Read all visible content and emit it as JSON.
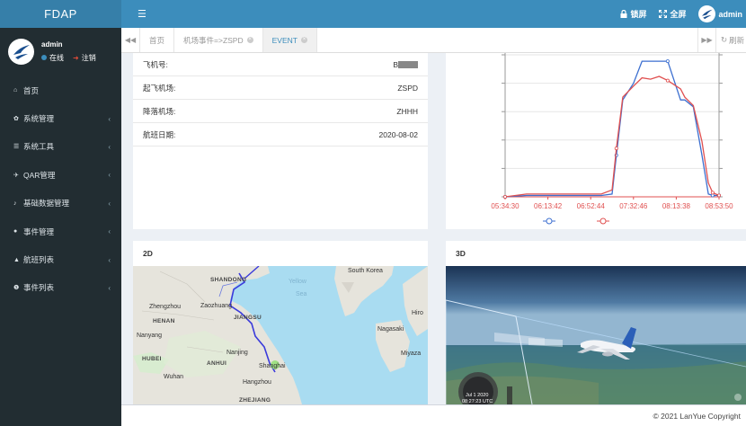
{
  "app": {
    "logo": "FDAP"
  },
  "user": {
    "name": "admin",
    "status_online": "在线",
    "status_logout": "注销"
  },
  "sidebar": {
    "items": [
      {
        "icon": "home-icon",
        "label": "首页",
        "has_children": false
      },
      {
        "icon": "gear-icon",
        "label": "系统管理",
        "has_children": true
      },
      {
        "icon": "list-icon",
        "label": "系统工具",
        "has_children": true
      },
      {
        "icon": "plane-icon",
        "label": "QAR管理",
        "has_children": true
      },
      {
        "icon": "bell-icon",
        "label": "基础数据管理",
        "has_children": true
      },
      {
        "icon": "circle-icon",
        "label": "事件管理",
        "has_children": true
      },
      {
        "icon": "warning-icon",
        "label": "航班列表",
        "has_children": true
      },
      {
        "icon": "info-icon",
        "label": "事件列表",
        "has_children": true
      }
    ]
  },
  "header": {
    "lock_label": "锁屏",
    "fullscreen_label": "全屏",
    "user_label": "admin"
  },
  "tabs": {
    "items": [
      {
        "label": "首页",
        "closable": false,
        "active": false
      },
      {
        "label": "机场事件=>ZSPD",
        "closable": true,
        "active": false
      },
      {
        "label": "EVENT",
        "closable": true,
        "active": true
      }
    ],
    "refresh_label": "刷新"
  },
  "flight_info": {
    "rows": [
      {
        "label": "飞机号:",
        "value": "B"
      },
      {
        "label": "起飞机场:",
        "value": "ZSPD"
      },
      {
        "label": "降落机场:",
        "value": "ZHHH"
      },
      {
        "label": "航班日期:",
        "value": "2020-08-02"
      }
    ]
  },
  "chart_data": {
    "type": "line",
    "x_ticks": [
      "05:34:30",
      "06:13:42",
      "06:52:44",
      "07:32:46",
      "08:13:38",
      "08:53:50"
    ],
    "series": [
      {
        "color": "#3c6fd0",
        "marker": "circle",
        "x": [
          0,
          0.1,
          0.2,
          0.3,
          0.45,
          0.5,
          0.52,
          0.55,
          0.6,
          0.64,
          0.68,
          0.72,
          0.76,
          0.82,
          0.84,
          0.88,
          0.92,
          0.95,
          0.97,
          1.0
        ],
        "y": [
          0,
          0.01,
          0.01,
          0.01,
          0.01,
          0.02,
          0.3,
          0.7,
          0.82,
          0.98,
          0.98,
          0.98,
          0.98,
          0.7,
          0.7,
          0.65,
          0.3,
          0.02,
          0.01,
          0.01
        ]
      },
      {
        "color": "#e05050",
        "marker": "circle",
        "x": [
          0,
          0.1,
          0.2,
          0.3,
          0.45,
          0.5,
          0.52,
          0.55,
          0.6,
          0.64,
          0.68,
          0.72,
          0.76,
          0.82,
          0.84,
          0.88,
          0.92,
          0.95,
          0.97,
          1.0
        ],
        "y": [
          0,
          0.02,
          0.02,
          0.02,
          0.02,
          0.05,
          0.35,
          0.72,
          0.8,
          0.86,
          0.85,
          0.87,
          0.84,
          0.78,
          0.72,
          0.66,
          0.4,
          0.1,
          0.03,
          0.01
        ]
      }
    ]
  },
  "map_panel": {
    "title": "2D",
    "labels": [
      {
        "text": "SHANDONG",
        "bold": true
      },
      {
        "text": "Yellow",
        "sea": true
      },
      {
        "text": "Sea",
        "sea": true
      },
      {
        "text": "South Korea"
      },
      {
        "text": "Zhengzhou"
      },
      {
        "text": "Zaozhuang"
      },
      {
        "text": "HENAN",
        "bold": true
      },
      {
        "text": "JIANGSU",
        "bold": true
      },
      {
        "text": "Hiro"
      },
      {
        "text": "Nanyang"
      },
      {
        "text": "Nagasaki"
      },
      {
        "text": "HUBEI",
        "bold": true
      },
      {
        "text": "ANHUI",
        "bold": true
      },
      {
        "text": "Nanjing"
      },
      {
        "text": "Miyaza"
      },
      {
        "text": "Wuhan"
      },
      {
        "text": "Shanghai"
      },
      {
        "text": "Hangzhou"
      },
      {
        "text": "ZHEJIANG",
        "bold": true
      }
    ]
  },
  "scene_panel": {
    "title": "3D",
    "hud_date": "Jul 1 2020",
    "hud_time": "08:27:23 UTC"
  },
  "colors": {
    "header": "#3c8dbc",
    "logo": "#367fa9",
    "sidebar": "#222d32",
    "accent": "#3c8dbc"
  },
  "footer": {
    "copyright": "© 2021 LanYue Copyright"
  }
}
